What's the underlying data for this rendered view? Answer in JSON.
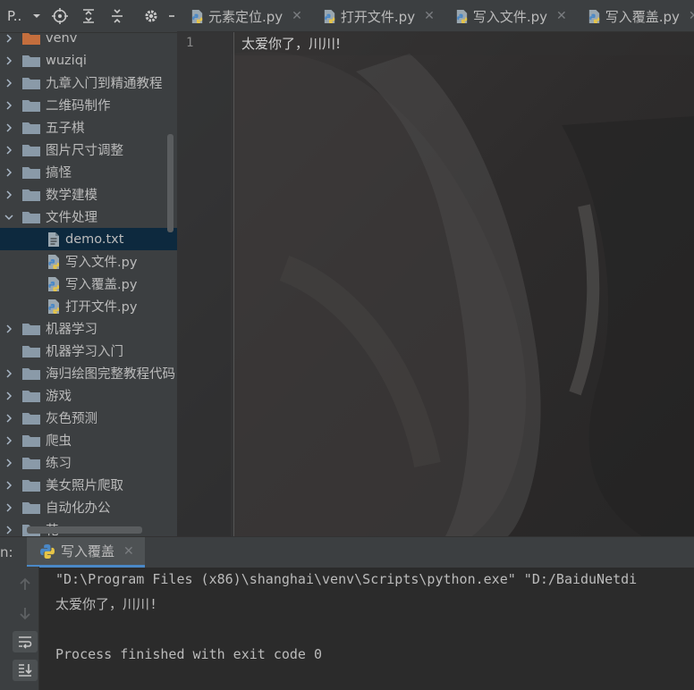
{
  "project": {
    "title": "P..",
    "tree": [
      {
        "label": "venv",
        "type": "folder",
        "color": "#c46e3d",
        "expanded": false
      },
      {
        "label": "wuziqi",
        "type": "folder",
        "expanded": false
      },
      {
        "label": "九章入门到精通教程",
        "type": "folder",
        "expanded": false
      },
      {
        "label": "二维码制作",
        "type": "folder",
        "expanded": false
      },
      {
        "label": "五子棋",
        "type": "folder",
        "expanded": false
      },
      {
        "label": "图片尺寸调整",
        "type": "folder",
        "expanded": false
      },
      {
        "label": "搞怪",
        "type": "folder",
        "expanded": false
      },
      {
        "label": "数学建模",
        "type": "folder",
        "expanded": false
      },
      {
        "label": "文件处理",
        "type": "folder",
        "expanded": true
      },
      {
        "label": "demo.txt",
        "type": "text-file",
        "selected": true
      },
      {
        "label": "写入文件.py",
        "type": "python-file"
      },
      {
        "label": "写入覆盖.py",
        "type": "python-file"
      },
      {
        "label": "打开文件.py",
        "type": "python-file"
      },
      {
        "label": "机器学习",
        "type": "folder",
        "expanded": false
      },
      {
        "label": "机器学习入门",
        "type": "folder",
        "noarrow": true
      },
      {
        "label": "海归绘图完整教程代码",
        "type": "folder",
        "expanded": false
      },
      {
        "label": "游戏",
        "type": "folder",
        "expanded": false
      },
      {
        "label": "灰色预测",
        "type": "folder",
        "expanded": false
      },
      {
        "label": "爬虫",
        "type": "folder",
        "expanded": false
      },
      {
        "label": "练习",
        "type": "folder",
        "expanded": false
      },
      {
        "label": "美女照片爬取",
        "type": "folder",
        "expanded": false
      },
      {
        "label": "自动化办公",
        "type": "folder",
        "expanded": false
      },
      {
        "label": "花",
        "type": "folder",
        "expanded": false
      }
    ]
  },
  "editor": {
    "tabs": [
      {
        "label": "元素定位.py",
        "active": false
      },
      {
        "label": "打开文件.py",
        "active": false
      },
      {
        "label": "写入文件.py",
        "active": false
      },
      {
        "label": "写入覆盖.py",
        "active": false
      }
    ],
    "line_number": "1",
    "code": "太爱你了，川川!"
  },
  "run": {
    "label": "n:",
    "tab_label": "写入覆盖",
    "console": [
      "\"D:\\Program Files (x86)\\shanghai\\venv\\Scripts\\python.exe\" \"D:/BaiduNetdi",
      "太爱你了，川川!",
      "",
      "Process finished with exit code 0"
    ]
  },
  "colors": {
    "accent": "#4a88c7",
    "folder": "#8a9aa8",
    "venv_folder": "#c46e3d",
    "selection": "#0d293e"
  }
}
